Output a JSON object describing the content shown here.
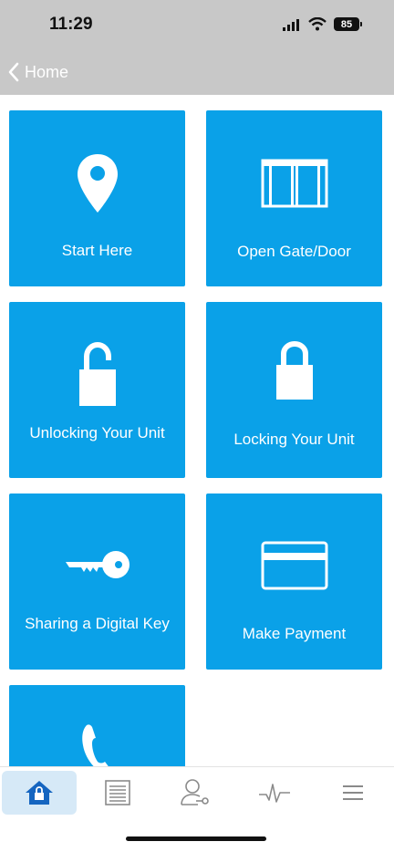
{
  "status": {
    "time": "11:29",
    "battery": "85"
  },
  "nav": {
    "back_label": "Home"
  },
  "tiles": [
    {
      "label": "Start Here",
      "icon": "map-pin-icon"
    },
    {
      "label": "Open Gate/Door",
      "icon": "gate-icon"
    },
    {
      "label": "Unlocking Your Unit",
      "icon": "unlocked-padlock-icon"
    },
    {
      "label": "Locking Your Unit",
      "icon": "locked-padlock-icon"
    },
    {
      "label": "Sharing a Digital Key",
      "icon": "key-icon"
    },
    {
      "label": "Make Payment",
      "icon": "credit-card-icon"
    },
    {
      "label": "",
      "icon": "phone-icon"
    }
  ],
  "tabs": [
    {
      "name": "home",
      "icon": "home-lock-icon",
      "active": true
    },
    {
      "name": "units",
      "icon": "storage-door-icon",
      "active": false
    },
    {
      "name": "access",
      "icon": "user-key-icon",
      "active": false
    },
    {
      "name": "activity",
      "icon": "activity-icon",
      "active": false
    },
    {
      "name": "menu",
      "icon": "menu-icon",
      "active": false
    }
  ],
  "colors": {
    "tile": "#0aa1e8",
    "header": "#c8c8c8",
    "active_tab": "#d6e9f7",
    "icon_active": "#1565c0"
  }
}
